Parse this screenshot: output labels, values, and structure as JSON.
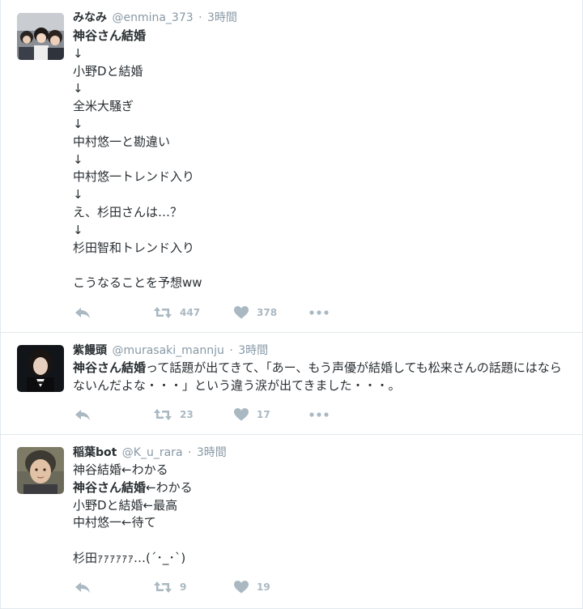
{
  "tweets": [
    {
      "name": "みなみ",
      "handle": "@enmina_373",
      "dot": "·",
      "time": "3時間",
      "lines": [
        {
          "pre": "",
          "bold": "神谷さん結婚",
          "post": ""
        },
        {
          "pre": "↓",
          "bold": "",
          "post": ""
        },
        {
          "pre": "小野Dと結婚",
          "bold": "",
          "post": ""
        },
        {
          "pre": "↓",
          "bold": "",
          "post": ""
        },
        {
          "pre": "全米大騒ぎ",
          "bold": "",
          "post": ""
        },
        {
          "pre": "↓",
          "bold": "",
          "post": ""
        },
        {
          "pre": "中村悠一と勘違い",
          "bold": "",
          "post": ""
        },
        {
          "pre": "↓",
          "bold": "",
          "post": ""
        },
        {
          "pre": "中村悠一トレンド入り",
          "bold": "",
          "post": ""
        },
        {
          "pre": "↓",
          "bold": "",
          "post": ""
        },
        {
          "pre": "え、杉田さんは…？",
          "bold": "",
          "post": ""
        },
        {
          "pre": "↓",
          "bold": "",
          "post": ""
        },
        {
          "pre": "杉田智和トレンド入り",
          "bold": "",
          "post": ""
        },
        {
          "pre": "",
          "bold": "",
          "post": ""
        },
        {
          "pre": "こうなることを予想ww",
          "bold": "",
          "post": ""
        }
      ],
      "retweets": "447",
      "likes": "378"
    },
    {
      "name": "紫饅頭",
      "handle": "@murasaki_mannju",
      "dot": "·",
      "time": "3時間",
      "lines": [
        {
          "pre": "",
          "bold": "神谷さん結婚",
          "post": "って話題が出てきて、「あー、もう声優が結婚しても松来さんの話題にはならないんだよな・・・」という違う涙が出てきました・・・。"
        }
      ],
      "retweets": "23",
      "likes": "17"
    },
    {
      "name": "稲葉bot",
      "handle": "@K_u_rara",
      "dot": "·",
      "time": "3時間",
      "lines": [
        {
          "pre": "神谷結婚←わかる",
          "bold": "",
          "post": ""
        },
        {
          "pre": "",
          "bold": "神谷さん結婚",
          "post": "←わかる"
        },
        {
          "pre": "小野Dと結婚←最高",
          "bold": "",
          "post": ""
        },
        {
          "pre": "中村悠一←待て",
          "bold": "",
          "post": ""
        },
        {
          "pre": "",
          "bold": "",
          "post": ""
        },
        {
          "pre": "杉田ｧｧｧｧｧｧ…(´･_･`)",
          "bold": "",
          "post": ""
        }
      ],
      "retweets": "9",
      "likes": "19"
    }
  ],
  "icons": [
    "reply-icon",
    "retweet-icon",
    "heart-icon",
    "more-icon"
  ],
  "colors": {
    "name": "#292f33",
    "meta": "#8899a6",
    "action": "#aab8c2",
    "divider": "#e1e8ed"
  }
}
